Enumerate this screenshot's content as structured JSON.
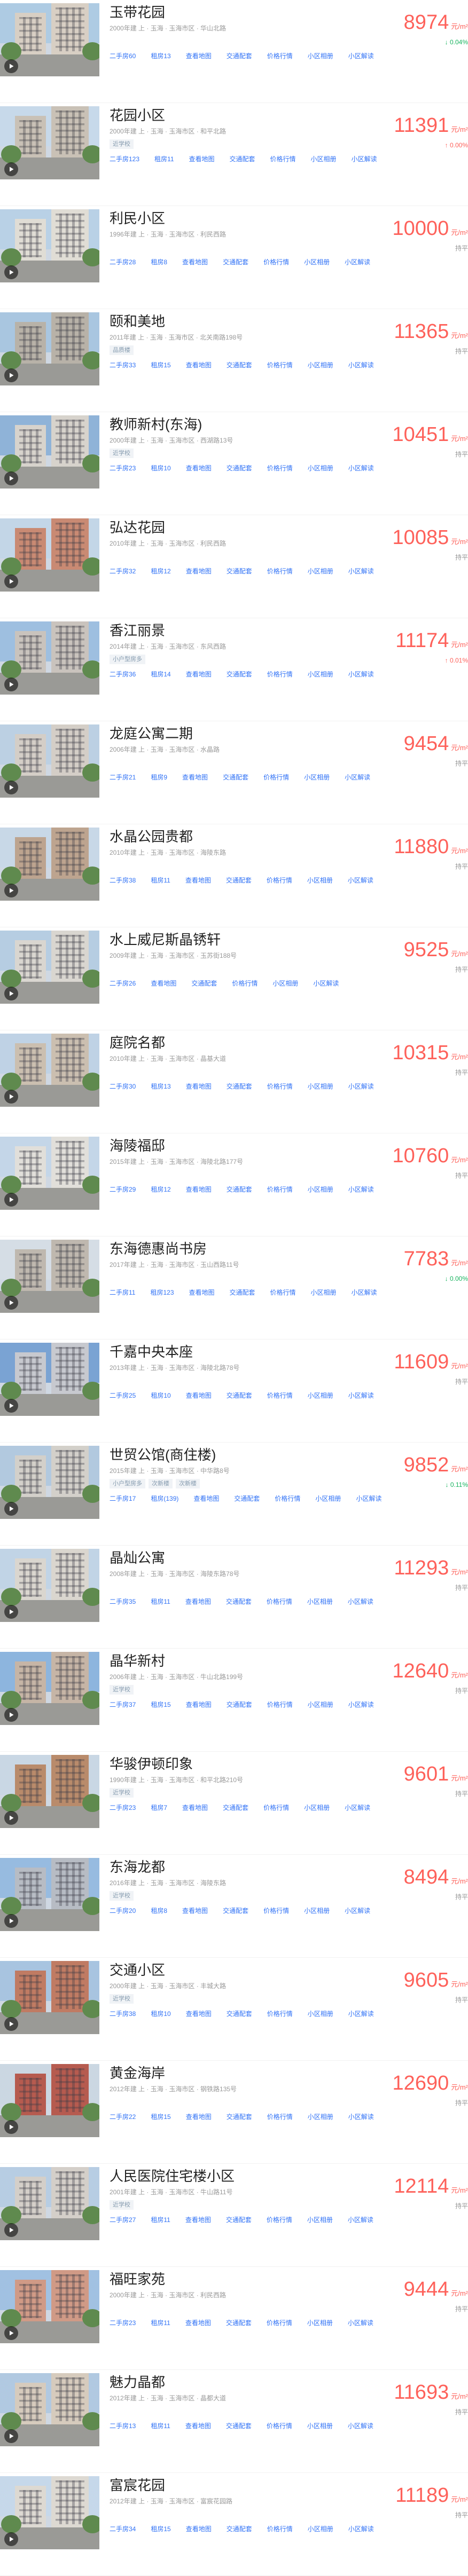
{
  "unit": "元/m²",
  "links": [
    "二手房",
    "租房",
    "查看地图",
    "交通配套",
    "价格行情",
    "小区相册",
    "小区解读"
  ],
  "items": [
    {
      "name": "玉带花园",
      "meta": "2000年建 上 · 玉海 · 玉海市区 · 华山北路",
      "sale": "二手房60",
      "rent": "租房13",
      "tags": [],
      "price": "8974",
      "trend": "↓ 0.04%",
      "dir": "down",
      "sky": "#aecbe3",
      "wall": "#d8cfc4"
    },
    {
      "name": "花园小区",
      "meta": "2000年建 上 · 玉海 · 玉海市区 · 和平北路",
      "sale": "二手房123",
      "rent": "租房11",
      "tags": [
        "近学校"
      ],
      "price": "11391",
      "trend": "↑ 0.00%",
      "dir": "up",
      "sky": "#c7d9ea",
      "wall": "#c9c1b6"
    },
    {
      "name": "利民小区",
      "meta": "1996年建 上 · 玉海 · 玉海市区 · 利民西路",
      "sale": "二手房28",
      "rent": "租房8",
      "tags": [],
      "price": "10000",
      "trend": "持平",
      "dir": "flat",
      "sky": "#b9d1e6",
      "wall": "#e0ddd5"
    },
    {
      "name": "颐和美地",
      "meta": "2011年建 上 · 玉海 · 玉海市区 · 北关南路198号",
      "sale": "二手房33",
      "rent": "租房15",
      "tags": [
        "品质楼"
      ],
      "price": "11365",
      "trend": "持平",
      "dir": "flat",
      "sky": "#a9c6e0",
      "wall": "#b8b2a8"
    },
    {
      "name": "教师新村(东海)",
      "meta": "2000年建 上 · 玉海 · 玉海市区 · 西湖路13号",
      "sale": "二手房23",
      "rent": "租房10",
      "tags": [
        "近学校"
      ],
      "price": "10451",
      "trend": "持平",
      "dir": "flat",
      "sky": "#8fb3d8",
      "wall": "#d7d3cc"
    },
    {
      "name": "弘达花园",
      "meta": "2010年建 上 · 玉海 · 玉海市区 · 利民西路",
      "sale": "二手房32",
      "rent": "租房12",
      "tags": [],
      "price": "10085",
      "trend": "持平",
      "dir": "flat",
      "sky": "#c3d6e7",
      "wall": "#c98a73"
    },
    {
      "name": "香江丽景",
      "meta": "2014年建 上 · 玉海 · 玉海市区 · 东风西路",
      "sale": "二手房36",
      "rent": "租房14",
      "tags": [
        "小户型房多"
      ],
      "price": "11174",
      "trend": "↑ 0.01%",
      "dir": "up",
      "sky": "#9ebfe0",
      "wall": "#c9c3bd"
    },
    {
      "name": "龙庭公寓二期",
      "meta": "2006年建 上 · 玉海 · 玉海市区 · 水晶路",
      "sale": "二手房21",
      "rent": "租房9",
      "tags": [],
      "price": "9454",
      "trend": "持平",
      "dir": "flat",
      "sky": "#bcd0e3",
      "wall": "#d4cec7"
    },
    {
      "name": "水晶公园贵都",
      "meta": "2010年建 上 · 玉海 · 玉海市区 · 海陵东路",
      "sale": "二手房38",
      "rent": "租房11",
      "tags": [],
      "price": "11880",
      "trend": "持平",
      "dir": "flat",
      "sky": "#c8d8e7",
      "wall": "#bda48f"
    },
    {
      "name": "水上威尼斯晶锈轩",
      "meta": "2009年建 上 · 玉海 · 玉海市区 · 玉苏街188号",
      "sale": "二手房26",
      "rent": "",
      "tags": [],
      "price": "9525",
      "trend": "持平",
      "dir": "flat",
      "sky": "#b6cde2",
      "wall": "#d9d6d0"
    },
    {
      "name": "庭院名都",
      "meta": "2010年建 上 · 玉海 · 玉海市区 · 晶基大道",
      "sale": "二手房30",
      "rent": "租房13",
      "tags": [],
      "price": "10315",
      "trend": "持平",
      "dir": "flat",
      "sky": "#bfd2e5",
      "wall": "#cbbfb0"
    },
    {
      "name": "海陵福邸",
      "meta": "2015年建 上 · 玉海 · 玉海市区 · 海陵北路177号",
      "sale": "二手房29",
      "rent": "租房12",
      "tags": [],
      "price": "10760",
      "trend": "持平",
      "dir": "flat",
      "sky": "#c4d6e8",
      "wall": "#e1dfda"
    },
    {
      "name": "东海德惠尚书房",
      "meta": "2017年建 上 · 玉海 · 玉海市区 · 玉山西路11号",
      "sale": "二手房11",
      "rent": "租房123",
      "tags": [],
      "price": "7783",
      "trend": "↓ 0.00%",
      "dir": "down",
      "sky": "#d5dde5",
      "wall": "#bfb8af"
    },
    {
      "name": "千嘉中央本座",
      "meta": "2013年建 上 · 玉海 · 玉海市区 · 海陵北路78号",
      "sale": "二手房25",
      "rent": "租房10",
      "tags": [],
      "price": "11609",
      "trend": "持平",
      "dir": "flat",
      "sky": "#7aa3d3",
      "wall": "#c7c9cf"
    },
    {
      "name": "世贸公馆(商住楼)",
      "meta": "2015年建 上 · 玉海 · 玉海市区 · 中华路8号",
      "sale": "二手房17",
      "rent": "租房(139)",
      "tags": [
        "小户型房多",
        "次新楼",
        "次新楼"
      ],
      "price": "9852",
      "trend": "↓ 0.11%",
      "dir": "down",
      "sky": "#b2c9df",
      "wall": "#d3d0ca"
    },
    {
      "name": "晶灿公寓",
      "meta": "2008年建 上 · 玉海 · 玉海市区 · 海陵东路78号",
      "sale": "二手房35",
      "rent": "租房11",
      "tags": [],
      "price": "11293",
      "trend": "持平",
      "dir": "flat",
      "sky": "#c1d4e6",
      "wall": "#dad6cf"
    },
    {
      "name": "晶华新村",
      "meta": "2006年建 上 · 玉海 · 玉海市区 · 牛山北路199号",
      "sale": "二手房37",
      "rent": "租房15",
      "tags": [
        "近学校"
      ],
      "price": "12640",
      "trend": "持平",
      "dir": "flat",
      "sky": "#8db5de",
      "wall": "#c6b5a6"
    },
    {
      "name": "华骏伊顿印象",
      "meta": "1990年建 上 · 玉海 · 玉海市区 · 和平北路210号",
      "sale": "二手房23",
      "rent": "租房7",
      "tags": [
        "近学校"
      ],
      "price": "9601",
      "trend": "持平",
      "dir": "flat",
      "sky": "#c9d7e4",
      "wall": "#b98b6b"
    },
    {
      "name": "东海龙都",
      "meta": "2016年建 上 · 玉海 · 玉海市区 · 海陵东路",
      "sale": "二手房20",
      "rent": "租房8",
      "tags": [
        "近学校"
      ],
      "price": "8494",
      "trend": "持平",
      "dir": "flat",
      "sky": "#97bbe0",
      "wall": "#b7bcc4"
    },
    {
      "name": "交通小区",
      "meta": "2000年建 上 · 玉海 · 玉海市区 · 丰城大路",
      "sale": "二手房38",
      "rent": "租房10",
      "tags": [
        "近学校"
      ],
      "price": "9605",
      "trend": "持平",
      "dir": "flat",
      "sky": "#a8c4e0",
      "wall": "#c07b63"
    },
    {
      "name": "黄金海岸",
      "meta": "2012年建 上 · 玉海 · 玉海市区 · 钢铁路135号",
      "sale": "二手房22",
      "rent": "租房15",
      "tags": [],
      "price": "12690",
      "trend": "持平",
      "dir": "flat",
      "sky": "#cbd7e2",
      "wall": "#b65b4f"
    },
    {
      "name": "人民医院住宅楼小区",
      "meta": "2001年建 上 · 玉海 · 玉海市区 · 牛山路11号",
      "sale": "二手房27",
      "rent": "租房11",
      "tags": [
        "近学校"
      ],
      "price": "12114",
      "trend": "持平",
      "dir": "flat",
      "sky": "#b7cde3",
      "wall": "#d4cfc9"
    },
    {
      "name": "福旺家苑",
      "meta": "2000年建 上 · 玉海 · 玉海市区 · 利民西路",
      "sale": "二手房23",
      "rent": "租房11",
      "tags": [],
      "price": "9444",
      "trend": "持平",
      "dir": "flat",
      "sky": "#a1c1e2",
      "wall": "#d09a86"
    },
    {
      "name": "魅力晶都",
      "meta": "2012年建 上 · 玉海 · 玉海市区 · 晶都大道",
      "sale": "二手房13",
      "rent": "租房11",
      "tags": [],
      "price": "11693",
      "trend": "持平",
      "dir": "flat",
      "sky": "#b1c9e1",
      "wall": "#d6cbbd"
    },
    {
      "name": "富宸花园",
      "meta": "2012年建 上 · 玉海 · 玉海市区 · 富宸花园路",
      "sale": "二手房34",
      "rent": "租房15",
      "tags": [],
      "price": "11189",
      "trend": "持平",
      "dir": "flat",
      "sky": "#c6d8ea",
      "wall": "#ddd9d2"
    }
  ]
}
